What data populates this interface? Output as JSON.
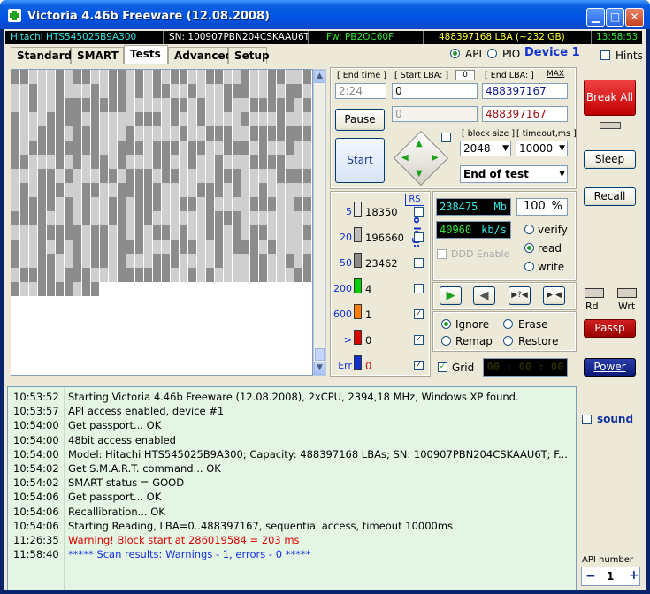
{
  "window": {
    "title": "Victoria 4.46b Freeware (12.08.2008)"
  },
  "info_bar": {
    "model": "Hitachi HTS545025B9A300",
    "serial": "SN: 100907PBN204CSKAAU6T",
    "firmware": "Fw: PB2OC60F",
    "capacity": "488397168 LBA (~232 GB)",
    "clock": "13:58:53"
  },
  "colors": {
    "model": "#37e6e6",
    "serial": "#ffffff",
    "firmware": "#34e834",
    "capacity": "#ffff33",
    "clock": "#34e834"
  },
  "tabs": [
    {
      "label": "Standard",
      "active": false
    },
    {
      "label": "SMART",
      "active": false
    },
    {
      "label": "Tests",
      "active": true
    },
    {
      "label": "Advanced",
      "active": false
    },
    {
      "label": "Setup",
      "active": false
    }
  ],
  "api_mode": {
    "api_label": "API",
    "pio_label": "PIO",
    "device_label": "Device 1",
    "selected": "API"
  },
  "hints_label": "Hints",
  "scan_grid": {
    "total_blocks": 520,
    "light_fraction": 0.45
  },
  "test_params": {
    "end_time_label": "[ End time ]",
    "end_time_value": "2:24",
    "start_lba_label": "[ Start LBA: ]",
    "start_lba_zero": "0",
    "start_lba_value": "0",
    "end_lba_label": "[ End LBA: ]",
    "end_lba_max": "MAX",
    "end_lba_value": "488397167",
    "current_lba": "488397167",
    "pause_field": "0",
    "pause_label": "Pause",
    "start_label": "Start",
    "block_size_label": "[ block size ]",
    "block_size_value": "2048",
    "timeout_label": "[ timeout,ms ]",
    "timeout_value": "10000",
    "end_action": "End of test"
  },
  "stats": {
    "rs_label": "RS",
    "to_log_label": "to log:",
    "rows": [
      {
        "ms": "5",
        "count": "18350",
        "color": "#e8e8e8",
        "log": false
      },
      {
        "ms": "20",
        "count": "196660",
        "color": "#bdbdbd",
        "log": false
      },
      {
        "ms": "50",
        "count": "23462",
        "color": "#8a8a8a",
        "log": false
      },
      {
        "ms": "200",
        "count": "4",
        "color": "#00d000",
        "log": false
      },
      {
        "ms": "600",
        "count": "1",
        "color": "#ff8000",
        "log": true
      },
      {
        "ms": ">",
        "count": "0",
        "color": "#e00000",
        "log": true
      },
      {
        "ms": "Err",
        "count": "0",
        "color": "#1030d0",
        "log": true
      }
    ]
  },
  "readout": {
    "mb_value": "238475",
    "mb_unit": "Mb",
    "percent": "100",
    "percent_unit": "%",
    "speed": "40960",
    "speed_unit": "kb/s",
    "ddd_label": "DDD Enable",
    "mode_options": [
      "verify",
      "read",
      "write"
    ],
    "mode_selected": "read"
  },
  "actions": {
    "options": [
      "Ignore",
      "Erase",
      "Remap",
      "Restore"
    ],
    "selected": "Ignore",
    "grid_label": "Grid",
    "grid_checked": true,
    "timer": "00 : 00 : 00"
  },
  "right_panel": {
    "break_all": "Break All",
    "sleep": "Sleep",
    "recall": "Recall",
    "rd": "Rd",
    "wrt": "Wrt",
    "passp": "Passp",
    "power": "Power",
    "sound": "sound",
    "api_number_label": "API number",
    "api_number": "1",
    "minus": "−",
    "plus": "+"
  },
  "log": [
    {
      "time": "10:53:52",
      "msg": "Starting Victoria 4.46b Freeware (12.08.2008), 2xCPU, 2394,18 MHz, Windows XP found.",
      "color": "#000000"
    },
    {
      "time": "10:53:57",
      "msg": "API access enabled, device #1",
      "color": "#000000"
    },
    {
      "time": "10:54:00",
      "msg": "Get passport... OK",
      "color": "#000000"
    },
    {
      "time": "10:54:00",
      "msg": "48bit access enabled",
      "color": "#000000"
    },
    {
      "time": "10:54:00",
      "msg": "Model: Hitachi HTS545025B9A300; Capacity: 488397168 LBAs; SN: 100907PBN204CSKAAU6T; F...",
      "color": "#000000"
    },
    {
      "time": "10:54:02",
      "msg": "Get S.M.A.R.T. command... OK",
      "color": "#000000"
    },
    {
      "time": "10:54:02",
      "msg": "SMART status = GOOD",
      "color": "#000000"
    },
    {
      "time": "10:54:06",
      "msg": "Get passport... OK",
      "color": "#000000"
    },
    {
      "time": "10:54:06",
      "msg": "Recallibration... OK",
      "color": "#000000"
    },
    {
      "time": "10:54:06",
      "msg": "Starting Reading, LBA=0..488397167, sequential access, timeout 10000ms",
      "color": "#000000"
    },
    {
      "time": "11:26:35",
      "msg": "Warning! Block start at 286019584 = 203 ms",
      "color": "#e00000"
    },
    {
      "time": "11:58:40",
      "msg": "***** Scan results: Warnings - 1, errors - 0 *****",
      "color": "#1030e0"
    }
  ]
}
